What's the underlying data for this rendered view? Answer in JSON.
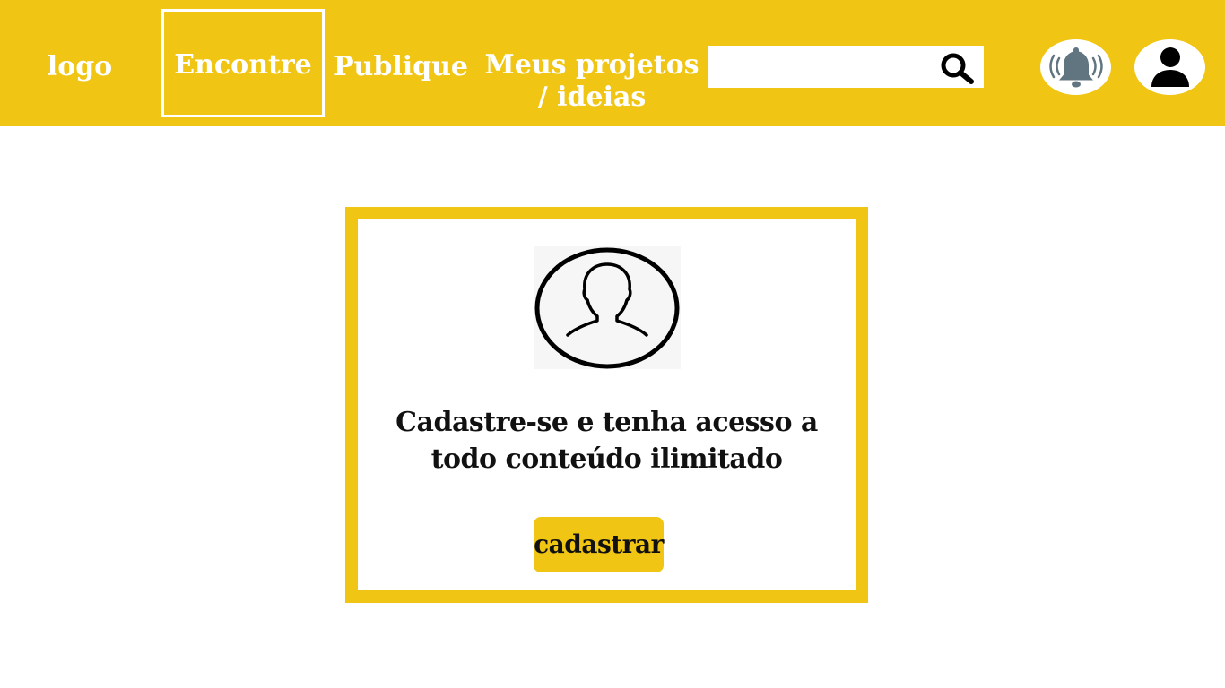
{
  "header": {
    "logo_text": "logo",
    "nav": {
      "encontre": "Encontre",
      "publique": "Publique",
      "meus_projetos_line1": "Meus projetos",
      "meus_projetos_line2": "/ ideias"
    },
    "search": {
      "value": "",
      "placeholder": "",
      "icon": "search-icon"
    },
    "notification_icon": "bell-icon",
    "profile_icon": "user-icon"
  },
  "signup_card": {
    "avatar_icon": "user-avatar-icon",
    "message_line1": "Cadastre-se e tenha acesso a",
    "message_line2": "todo conteúdo ilimitado",
    "button_label": "cadastrar"
  },
  "colors": {
    "accent": "#f0c513",
    "background": "#ffffff",
    "text_dark": "#111111",
    "bell": "#607580"
  }
}
